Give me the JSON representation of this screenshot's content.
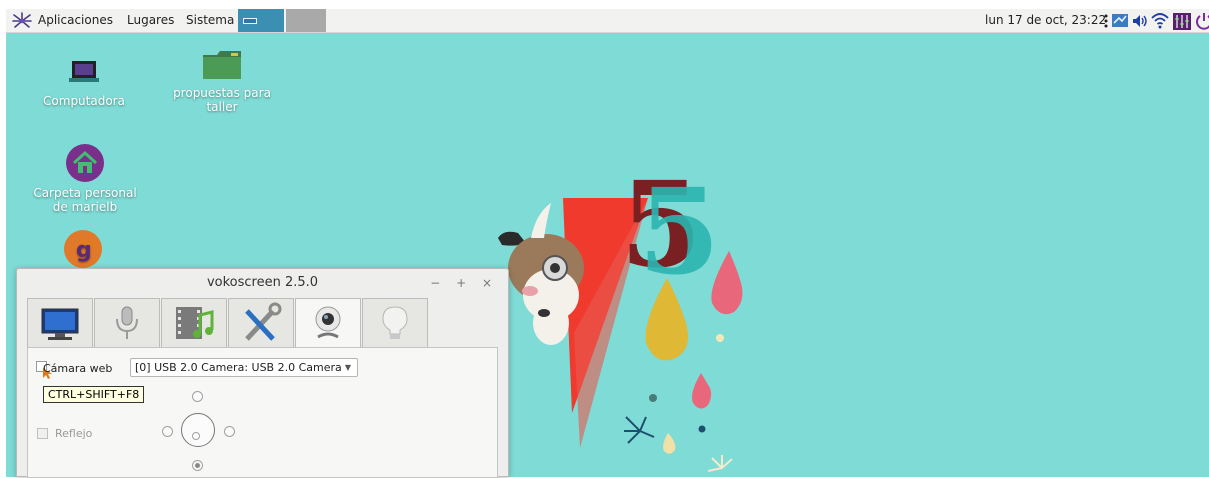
{
  "panel": {
    "menus": [
      "Aplicaciones",
      "Lugares",
      "Sistema"
    ],
    "clock": "lun 17 de oct, 23:22"
  },
  "desktop": {
    "icons": [
      {
        "label": "Computadora"
      },
      {
        "label": "propuestas para taller"
      },
      {
        "label": "Carpeta personal de marielb"
      }
    ],
    "wallpaper_number": "5"
  },
  "window": {
    "title": "vokoscreen 2.5.0",
    "controls": "− + ×",
    "tabs": [
      "screen-tab",
      "audio-tab",
      "video-tab",
      "settings-tab",
      "webcam-tab",
      "about-tab"
    ],
    "active_tab": 4,
    "webcam": {
      "checkbox_label": "Cámara web",
      "camera_select": "[0] USB 2.0 Camera: USB 2.0 Camera",
      "tooltip": "CTRL+SHIFT+F8",
      "mirror_label": "Reflejo"
    }
  },
  "colors": {
    "desktop": "#7fdbd5",
    "panel": "#f2f2f0",
    "task_active": "#3b8fb3"
  }
}
